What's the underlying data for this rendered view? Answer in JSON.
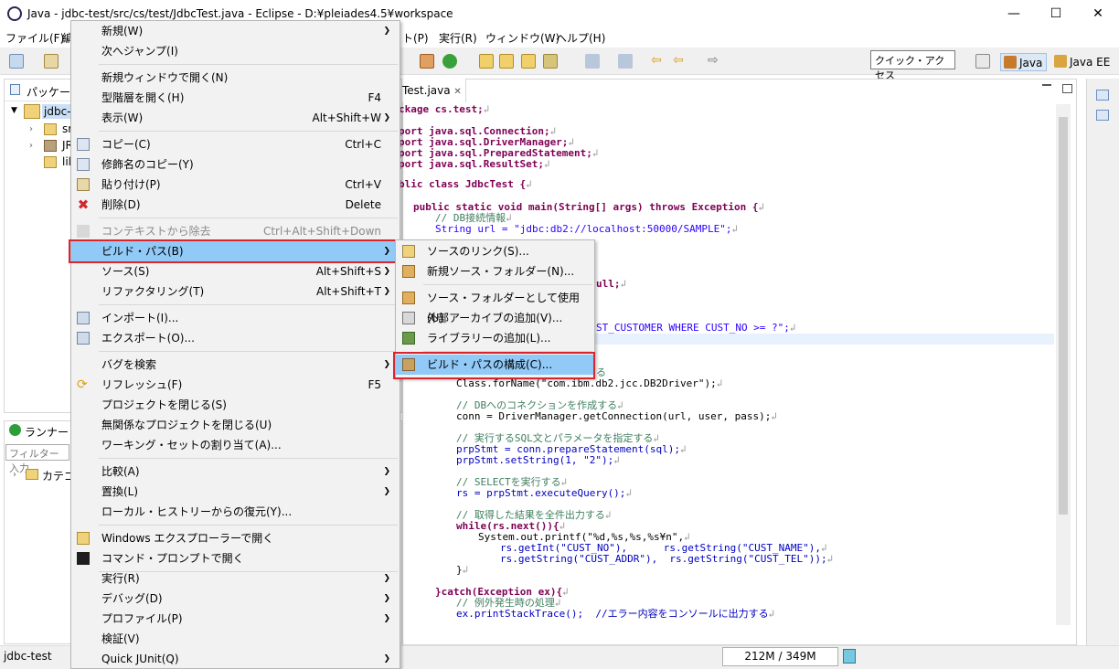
{
  "window": {
    "title": "Java - jdbc-test/src/cs/test/JdbcTest.java - Eclipse - D:¥pleiades4.5¥workspace",
    "minimize": "—",
    "maximize": "☐",
    "close": "✕"
  },
  "menubar": [
    "ファイル(F)",
    "編",
    "ト(P)",
    "実行(R)",
    "ウィンドウ(W)",
    "ヘルプ(H)"
  ],
  "quick_access": {
    "placeholder": "クイック・アクセス"
  },
  "perspectives": [
    "Java",
    "Java EE"
  ],
  "package_explorer": {
    "title": "パッケージ・",
    "items": [
      {
        "label": "jdbc-"
      },
      {
        "label": "src"
      },
      {
        "label": "JR"
      },
      {
        "label": "lil"
      }
    ]
  },
  "runner": {
    "title": "ランナー",
    "filter_placeholder": "フィルター入力",
    "category": "カテゴ"
  },
  "editor": {
    "tab": "Test.java",
    "lines": [
      "ckage cs.test;",
      "port java.sql.Connection;",
      "port java.sql.DriverManager;",
      "port java.sql.PreparedStatement;",
      "port java.sql.ResultSet;",
      "blic class JdbcTest {",
      "public static void main(String[] args) throws Exception {",
      "// DB接続情報",
      "String url = \"jdbc:db2://localhost:50000/SAMPLE\";",
      "ull;",
      "ST_CUSTOMER WHERE CUST_NO >= ?\";",
      "る",
      "Class.forName(\"com.ibm.db2.jcc.DB2Driver\");",
      "// DBへのコネクションを作成する",
      "conn = DriverManager.getConnection(url, user, pass);",
      "// 実行するSQL文とパラメータを指定する",
      "prpStmt = conn.prepareStatement(sql);",
      "prpStmt.setString(1, \"2\");",
      "// SELECTを実行する",
      "rs = prpStmt.executeQuery();",
      "// 取得した結果を全件出力する",
      "while(rs.next()){",
      "System.out.printf(\"%d,%s,%s,%s¥n\",",
      "rs.getInt(\"CUST_NO\"),      rs.getString(\"CUST_NAME\"),",
      "rs.getString(\"CUST_ADDR\"),  rs.getString(\"CUST_TEL\"));",
      "}",
      "}catch(Exception ex){",
      "// 例外発生時の処理",
      "ex.printStackTrace();  //エラー内容をコンソールに出力する"
    ]
  },
  "context_menu": [
    {
      "label": "新規(W)",
      "submenu": true
    },
    {
      "label": "次へジャンプ(I)"
    },
    {
      "label": "新規ウィンドウで開く(N)"
    },
    {
      "label": "型階層を開く(H)",
      "accel": "F4"
    },
    {
      "label": "表示(W)",
      "accel": "Alt+Shift+W",
      "submenu": true
    },
    {
      "label": "コピー(C)",
      "accel": "Ctrl+C",
      "icon": "copy-icon"
    },
    {
      "label": "修飾名のコピー(Y)",
      "icon": "copy-qualified-icon"
    },
    {
      "label": "貼り付け(P)",
      "accel": "Ctrl+V",
      "icon": "paste-icon"
    },
    {
      "label": "削除(D)",
      "accel": "Delete",
      "icon": "delete-icon"
    },
    {
      "label": "コンテキストから除去",
      "accel": "Ctrl+Alt+Shift+Down",
      "disabled": true,
      "icon": "remove-context-icon"
    },
    {
      "label": "ビルド・パス(B)",
      "submenu": true,
      "highlighted": true
    },
    {
      "label": "ソース(S)",
      "accel": "Alt+Shift+S",
      "submenu": true
    },
    {
      "label": "リファクタリング(T)",
      "accel": "Alt+Shift+T",
      "submenu": true
    },
    {
      "label": "インポート(I)...",
      "icon": "import-icon"
    },
    {
      "label": "エクスポート(O)...",
      "icon": "export-icon"
    },
    {
      "label": "バグを検索",
      "submenu": true
    },
    {
      "label": "リフレッシュ(F)",
      "accel": "F5",
      "icon": "refresh-icon"
    },
    {
      "label": "プロジェクトを閉じる(S)"
    },
    {
      "label": "無関係なプロジェクトを閉じる(U)"
    },
    {
      "label": "ワーキング・セットの割り当て(A)..."
    },
    {
      "label": "比較(A)",
      "submenu": true
    },
    {
      "label": "置換(L)",
      "submenu": true
    },
    {
      "label": "ローカル・ヒストリーからの復元(Y)..."
    },
    {
      "label": "Windows エクスプローラーで開く",
      "icon": "explorer-icon"
    },
    {
      "label": "コマンド・プロンプトで開く",
      "icon": "command-prompt-icon"
    },
    {
      "label": "実行(R)",
      "submenu": true
    },
    {
      "label": "デバッグ(D)",
      "submenu": true
    },
    {
      "label": "プロファイル(P)",
      "submenu": true
    },
    {
      "label": "検証(V)"
    },
    {
      "label": "Quick JUnit(Q)",
      "submenu": true
    }
  ],
  "build_path_submenu": [
    {
      "label": "ソースのリンク(S)..."
    },
    {
      "label": "新規ソース・フォルダー(N)..."
    },
    {
      "label": "ソース・フォルダーとして使用(U)"
    },
    {
      "label": "外部アーカイブの追加(V)..."
    },
    {
      "label": "ライブラリーの追加(L)..."
    },
    {
      "label": "ビルド・パスの構成(C)...",
      "highlighted": true
    }
  ],
  "status": {
    "project": "jdbc-test",
    "memory": "212M / 349M",
    "memory_used_fraction": 0.61
  }
}
